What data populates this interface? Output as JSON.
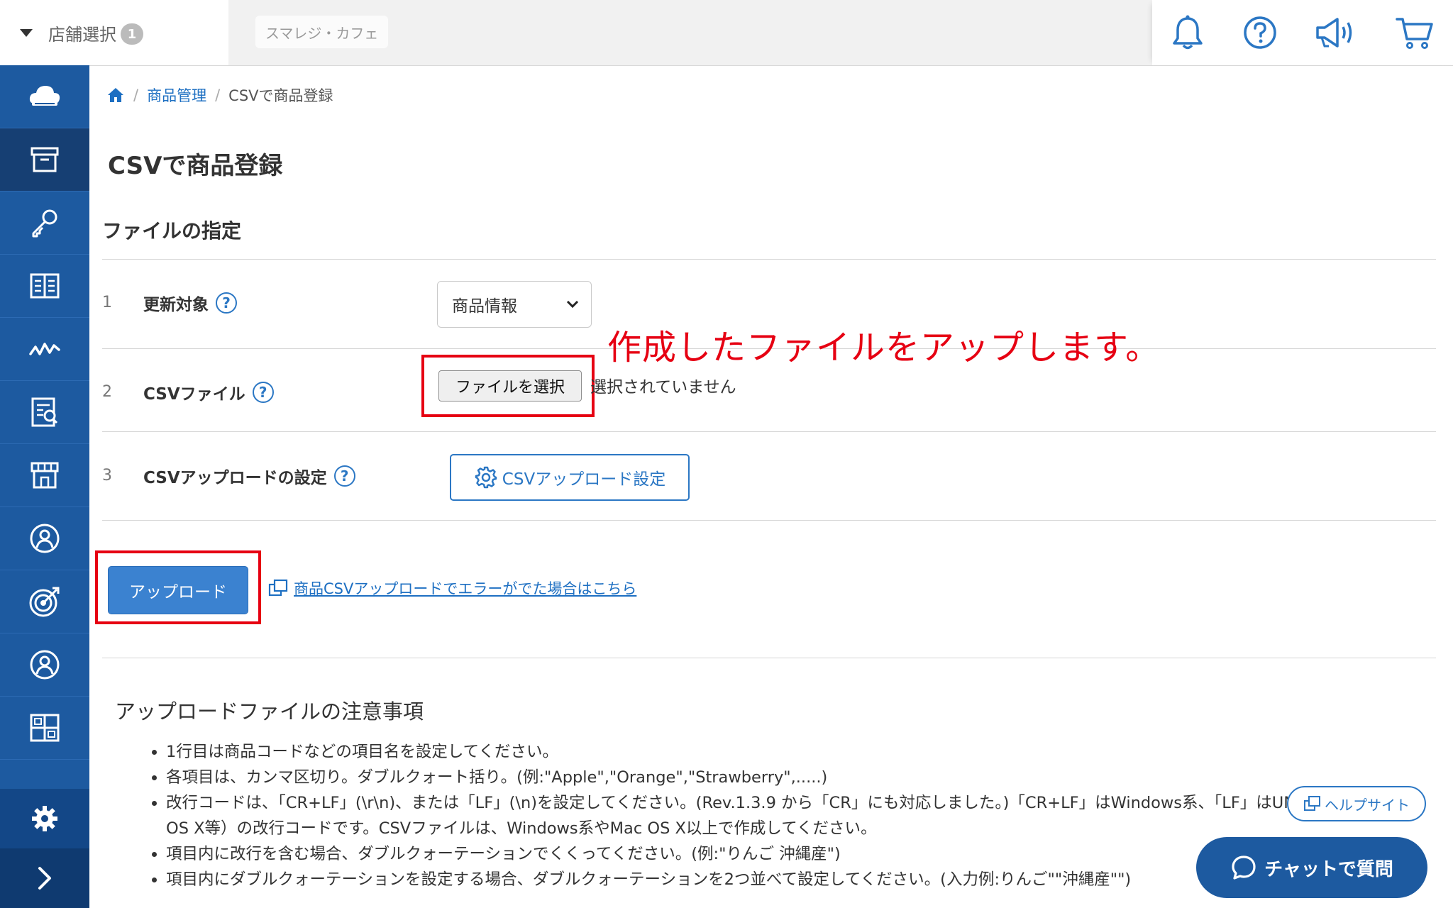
{
  "header": {
    "store_select_label": "店舗選択",
    "store_count": "1",
    "store_name": "スマレジ・カフェ",
    "icons": [
      "bell-icon",
      "help-icon",
      "megaphone-icon",
      "cart-icon"
    ]
  },
  "sidebar": {
    "items": [
      "cloud-home-icon",
      "product-box-icon",
      "key-icon",
      "book-icon",
      "sales-chart-icon",
      "report-icon",
      "store-icon",
      "customer-icon",
      "target-icon",
      "staff-icon",
      "apps-icon"
    ],
    "bottom": [
      "settings-gear-icon",
      "expand-chevron-icon"
    ]
  },
  "breadcrumb": {
    "home_icon": "home-icon",
    "items": [
      "商品管理",
      "CSVで商品登録"
    ]
  },
  "page": {
    "title": "CSVで商品登録",
    "section_title": "ファイルの指定"
  },
  "form": {
    "rows": [
      {
        "num": "1",
        "label": "更新対象"
      },
      {
        "num": "2",
        "label": "CSVファイル"
      },
      {
        "num": "3",
        "label": "CSVアップロードの設定"
      }
    ],
    "target_select_value": "商品情報",
    "file_button_label": "ファイルを選択",
    "file_status": "選択されていません",
    "upload_settings_button": "CSVアップロード設定",
    "upload_button": "アップロード",
    "error_link": "商品CSVアップロードでエラーがでた場合はこちら",
    "help_glyph": "?"
  },
  "annotation": {
    "text": "作成したファイルをアップします。",
    "color": "#e60012"
  },
  "notes": {
    "title": "アップロードファイルの注意事項",
    "items": [
      "1行目は商品コードなどの項目名を設定してください。",
      "各項目は、カンマ区切り。ダブルクォート括り。(例:\"Apple\",\"Orange\",\"Strawberry\",.....)",
      "改行コードは、「CR+LF」(\\r\\n)、または「LF」(\\n)を設定してください。(Rev.1.3.9 から「CR」にも対応しました。)「CR+LF」はWindows系、「LF」はUNIX系（Mac OS X等）の改行コードです。CSVファイルは、Windows系やMac OS X以上で作成してください。",
      "項目内に改行を含む場合、ダブルクォーテーションでくくってください。(例:\"りんご 沖縄産\")",
      "項目内にダブルクォーテーションを設定する場合、ダブルクォーテーションを2つ並べて設定してください。(入力例:りんご\"\"沖縄産\"\")"
    ]
  },
  "floating": {
    "help_site": "ヘルプサイト",
    "chat": "チャットで質問"
  },
  "colors": {
    "sidebar": "#1d5aa0",
    "accent": "#2b77c4",
    "annotation_red": "#e60012"
  }
}
